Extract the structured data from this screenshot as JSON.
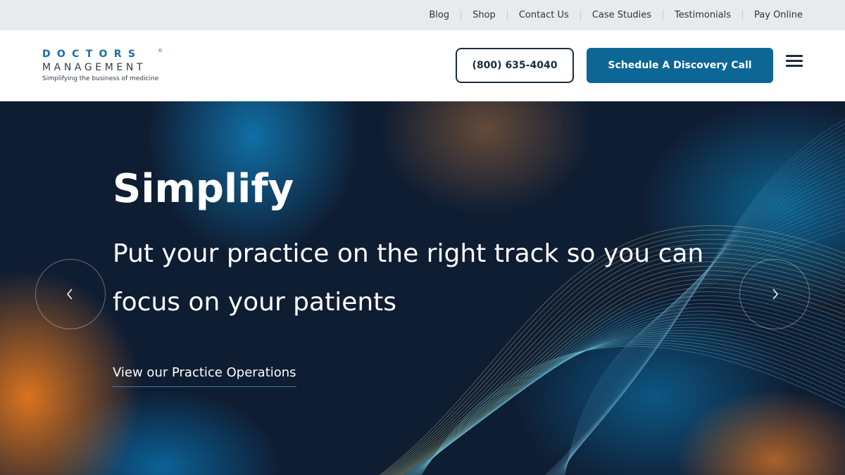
{
  "topnav": {
    "items": [
      {
        "label": "Blog"
      },
      {
        "label": "Shop"
      },
      {
        "label": "Contact Us"
      },
      {
        "label": "Case Studies"
      },
      {
        "label": "Testimonials"
      },
      {
        "label": "Pay Online"
      }
    ]
  },
  "logo": {
    "top": "DOCTORS",
    "reg": "®",
    "bottom": "MANAGEMENT",
    "tagline": "Simplifying the business of medicine"
  },
  "header": {
    "phone_label": "(800) 635-4040",
    "cta_label": "Schedule A Discovery Call",
    "menu_icon": "hamburger-icon"
  },
  "hero": {
    "title": "Simplify",
    "subtitle": "Put your practice on the right track so you can focus on your patients",
    "link_label": "View our Practice Operations",
    "prev_icon": "chevron-left-icon",
    "next_icon": "chevron-right-icon"
  },
  "colors": {
    "brand_blue": "#0c6796",
    "logo_blue": "#1a6ea3",
    "hero_bg": "#0f1d33",
    "accent_orange": "#e6781e",
    "topbar_bg": "#e8ebee"
  }
}
